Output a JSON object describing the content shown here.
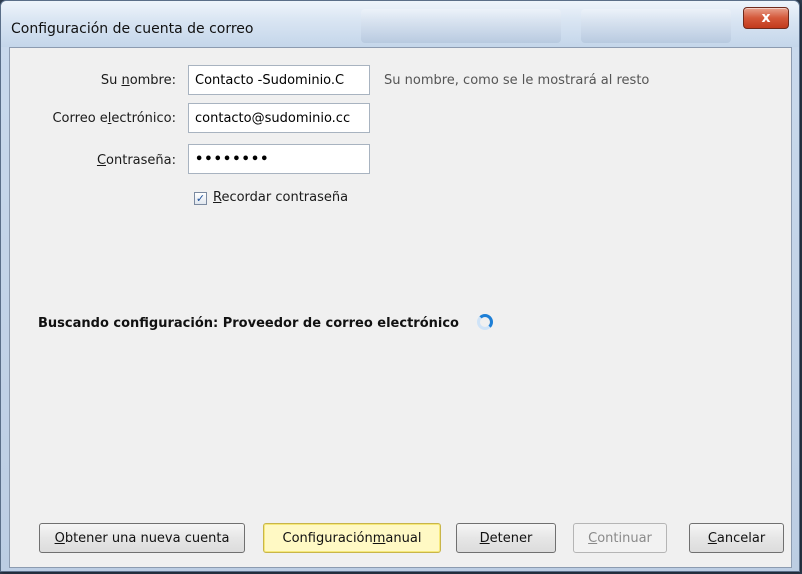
{
  "window": {
    "title": "Configuración de cuenta de correo",
    "close_label": "x"
  },
  "form": {
    "name": {
      "label_pre": "Su ",
      "label_key": "n",
      "label_post": "ombre:",
      "value": "Contacto -Sudominio.C",
      "hint": "Su nombre, como se le mostrará al resto"
    },
    "email": {
      "label_pre": "Correo e",
      "label_key": "l",
      "label_post": "ectrónico:",
      "value": "contacto@sudominio.cc"
    },
    "password": {
      "label_pre": "",
      "label_key": "C",
      "label_post": "ontraseña:",
      "value": "••••••••"
    },
    "remember": {
      "checked": true,
      "label_key": "R",
      "label_post": "ecordar contraseña"
    }
  },
  "status": {
    "text": "Buscando configuración: Proveedor de correo electrónico"
  },
  "buttons": {
    "new_account": {
      "key": "O",
      "rest": "btener una nueva cuenta"
    },
    "manual": {
      "pre": "Configuración ",
      "key": "m",
      "rest": "anual"
    },
    "stop": {
      "key": "D",
      "rest": "etener"
    },
    "continue": {
      "key": "C",
      "rest": "ontinuar"
    },
    "cancel": {
      "key": "C",
      "rest": "ancelar"
    }
  },
  "colors": {
    "highlight_button": "#fff9c4",
    "spinner": "#1e7fd6",
    "close_button": "#d4583a"
  }
}
